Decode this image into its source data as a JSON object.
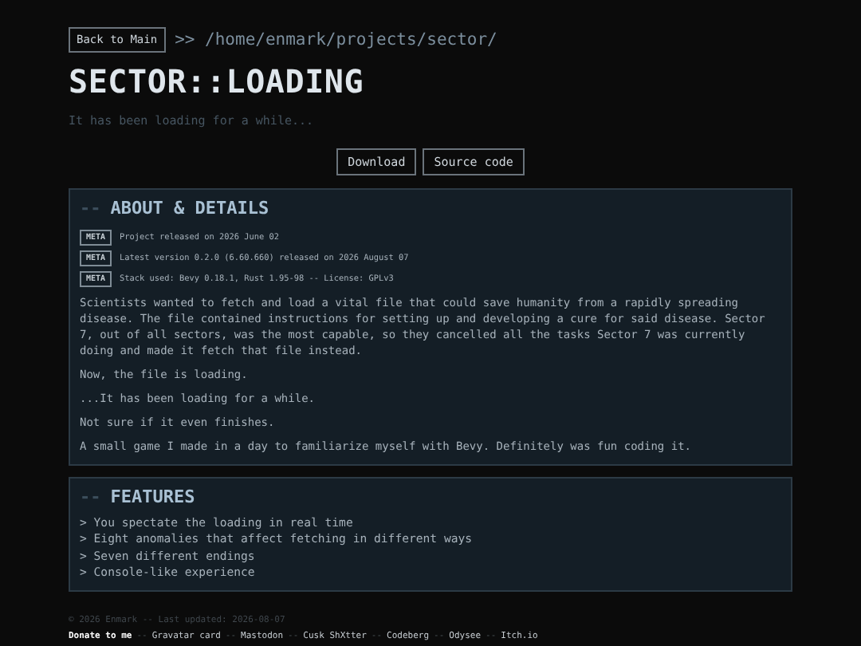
{
  "header": {
    "back_button": "Back to Main",
    "path": ">> /home/enmark/projects/sector/",
    "title": "SECTOR::LOADING",
    "subtitle": "It has been loading for a while..."
  },
  "actions": [
    "Download",
    "Source code"
  ],
  "about": {
    "title": "ABOUT & DETAILS",
    "prefix": "--",
    "meta": [
      {
        "tag": "META",
        "text": "Project released on 2026 June 02"
      },
      {
        "tag": "META",
        "text": "Latest version 0.2.0 (6.60.660) released on 2026 August 07"
      },
      {
        "tag": "META",
        "text": "Stack used: Bevy 0.18.1, Rust 1.95-98 -- License: GPLv3"
      }
    ],
    "paragraphs": [
      "Scientists wanted to fetch and load a vital file that could save humanity from a rapidly spreading disease. The file contained instructions for setting up and developing a cure for said disease. Sector 7, out of all sectors, was the most capable, so they cancelled all the tasks Sector 7 was currently doing and made it fetch that file instead.",
      "Now, the file is loading.",
      "...It has been loading for a while.",
      "Not sure if it even finishes.",
      "A small game I made in a day to familiarize myself with Bevy. Definitely was fun coding it."
    ]
  },
  "features": {
    "title": "FEATURES",
    "prefix": "--",
    "items": [
      "> You spectate the loading in real time",
      "> Eight anomalies that affect fetching in different ways",
      "> Seven different endings",
      "> Console-like experience"
    ]
  },
  "footer": {
    "copyright": "© 2026 Enmark -- Last updated: 2026-08-07",
    "separator": "--",
    "links": [
      {
        "label": "Donate to me",
        "bold": true
      },
      {
        "label": "Gravatar card",
        "bold": false
      },
      {
        "label": "Mastodon",
        "bold": false
      },
      {
        "label": "Cusk ShXtter",
        "bold": false
      },
      {
        "label": "Codeberg",
        "bold": false
      },
      {
        "label": "Odysee",
        "bold": false
      },
      {
        "label": "Itch.io",
        "bold": false
      }
    ]
  }
}
